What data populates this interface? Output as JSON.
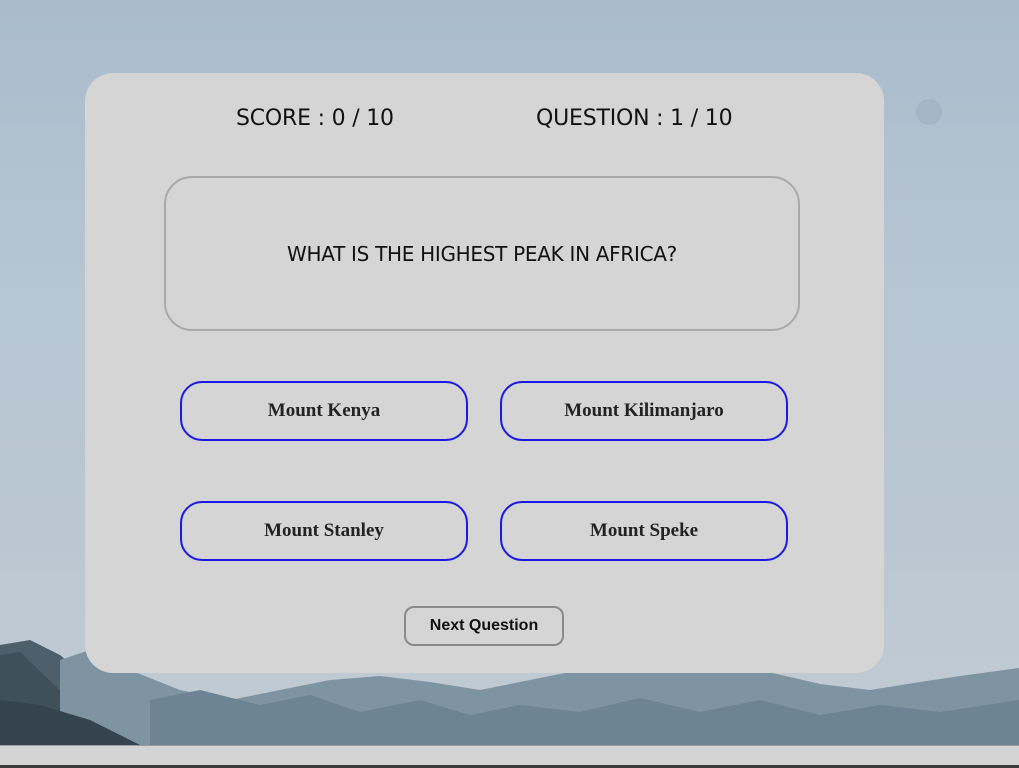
{
  "stats": {
    "score": "SCORE : 0 / 10",
    "question": "QUESTION : 1 / 10"
  },
  "question": {
    "text": "WHAT IS THE HIGHEST PEAK IN AFRICA?"
  },
  "answers": [
    "Mount Kenya",
    "Mount Kilimanjaro",
    "Mount Stanley",
    "Mount Speke"
  ],
  "next_label": "Next Question",
  "colors": {
    "answer_border": "#1a1ae6",
    "card_bg": "#d5d5d5"
  }
}
